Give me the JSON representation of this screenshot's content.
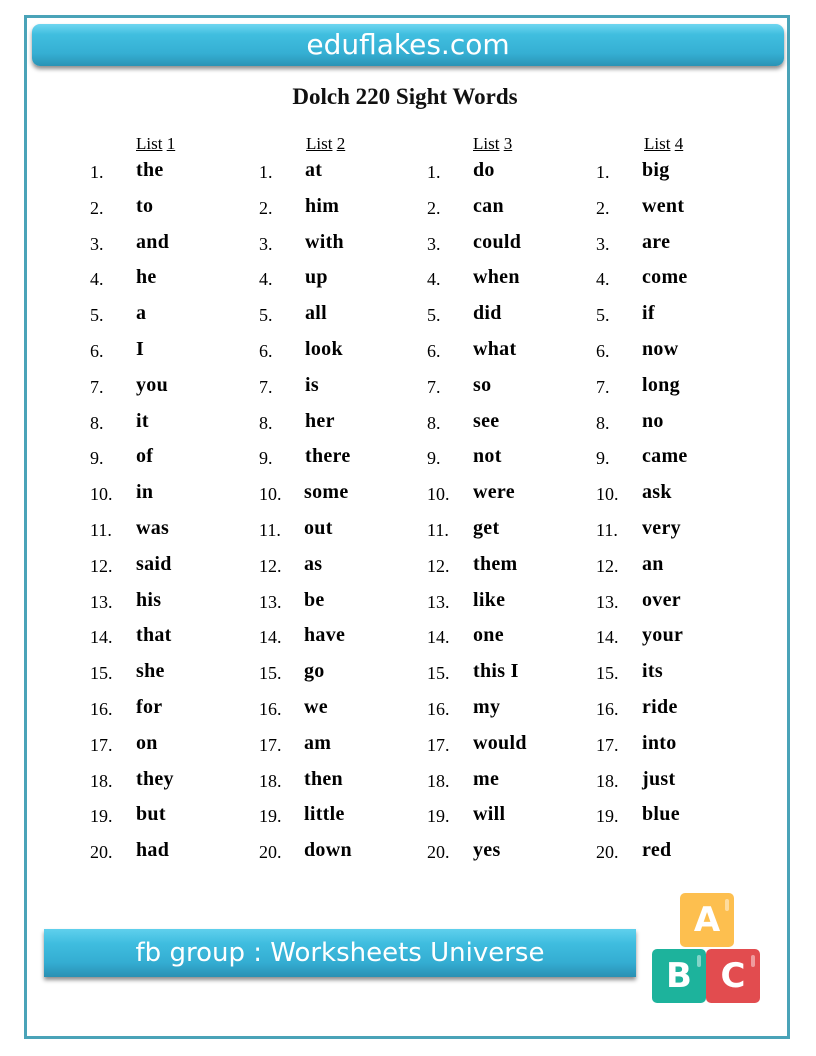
{
  "header": {
    "site": "eduflakes.com"
  },
  "title": "Dolch 220 Sight Words",
  "lists": [
    {
      "label_word": "List",
      "label_num": "1",
      "words": [
        "the",
        "to",
        "and",
        "he",
        "a",
        "I",
        "you",
        "it",
        "of",
        "in",
        "was",
        "said",
        "his",
        "that",
        "she",
        "for",
        "on",
        "they",
        "but",
        "had"
      ]
    },
    {
      "label_word": "List",
      "label_num": "2",
      "words": [
        "at",
        "him",
        "with",
        "up",
        "all",
        "look",
        "is",
        "her",
        "there",
        "some",
        "out",
        "as",
        "be",
        "have",
        "go",
        "we",
        "am",
        "then",
        "little",
        "down"
      ]
    },
    {
      "label_word": "List",
      "label_num": "3",
      "words": [
        "do",
        "can",
        "could",
        "when",
        "did",
        "what",
        "so",
        "see",
        "not",
        "were",
        "get",
        "them",
        "like",
        "one",
        "this I",
        "my",
        "would",
        "me",
        "will",
        "yes"
      ]
    },
    {
      "label_word": "List",
      "label_num": "4",
      "words": [
        "big",
        "went",
        "are",
        "come",
        "if",
        "now",
        "long",
        "no",
        "came",
        "ask",
        "very",
        "an",
        "over",
        "your",
        "its",
        "ride",
        "into",
        "just",
        "blue",
        "red"
      ]
    }
  ],
  "footer": {
    "banner": "fb group : Worksheets Universe"
  },
  "blocks": {
    "a": "A",
    "b": "B",
    "c": "C"
  },
  "colors": {
    "border": "#4aa3b8",
    "banner": "#35afd3",
    "block_a": "#fdbf4f",
    "block_b": "#1db39c",
    "block_c": "#e24c4f"
  }
}
